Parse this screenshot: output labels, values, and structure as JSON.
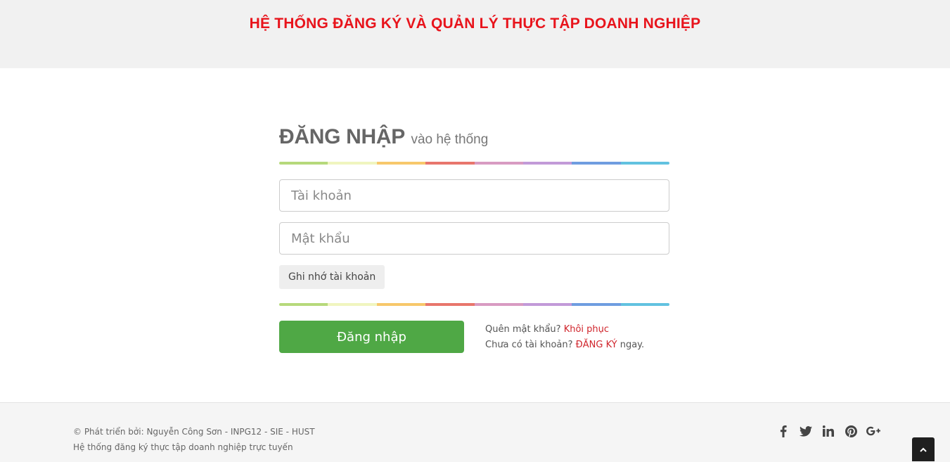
{
  "header": {
    "title": "HỆ THỐNG ĐĂNG KÝ VÀ QUẢN LÝ THỰC TẬP DOANH NGHIỆP"
  },
  "login": {
    "heading_main": "ĐĂNG NHẬP",
    "heading_sub": "vào hệ thống",
    "username_placeholder": "Tài khoản",
    "password_placeholder": "Mật khẩu",
    "remember_label": "Ghi nhớ tài khoản",
    "submit_label": "Đăng nhập",
    "forgot_text": "Quên mật khẩu?",
    "forgot_link": "Khôi phục",
    "no_account_text": "Chưa có tài khoản?",
    "register_link": "ĐĂNG KÝ",
    "register_suffix": "ngay.",
    "bar_colors": [
      "#b6d97b",
      "#f0f5bf",
      "#f7c86b",
      "#e8766c",
      "#d89bc2",
      "#c29ad8",
      "#6f9de0",
      "#62c2e0"
    ]
  },
  "footer": {
    "line1": "© Phát triển bởi: Nguyễn Công Sơn - INPG12 - SIE - HUST",
    "line2": "Hệ thống đăng ký thực tập doanh nghiệp trực tuyến",
    "social_icons": [
      "facebook-icon",
      "twitter-icon",
      "linkedin-icon",
      "pinterest-icon",
      "google-plus-icon"
    ]
  },
  "colors": {
    "header_title": "#e8141c",
    "login_button": "#4fa845",
    "link": "#d0252c"
  }
}
